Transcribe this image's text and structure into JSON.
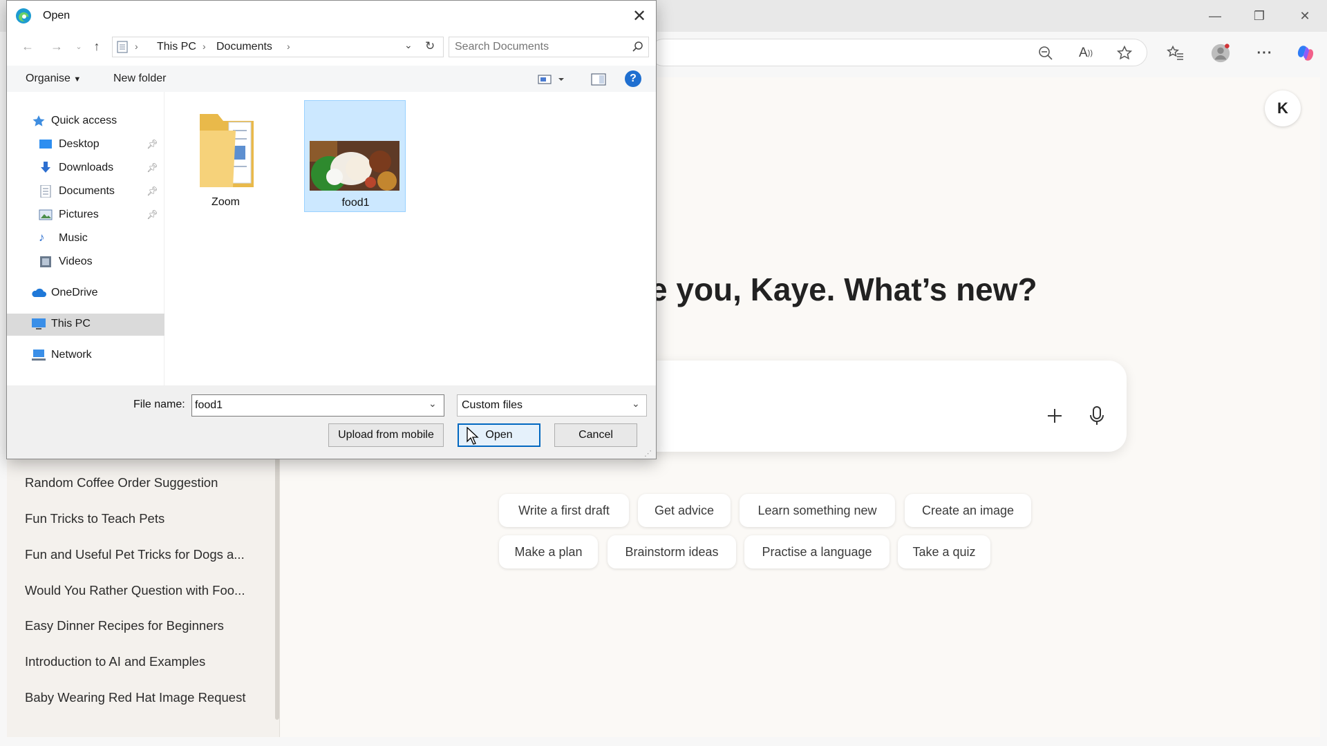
{
  "dialog": {
    "title": "Open",
    "breadcrumb": [
      "This PC",
      "Documents"
    ],
    "search_placeholder": "Search Documents",
    "commands": {
      "organise": "Organise",
      "new_folder": "New folder"
    },
    "nav": {
      "quick_access": "Quick access",
      "desktop": "Desktop",
      "downloads": "Downloads",
      "documents": "Documents",
      "pictures": "Pictures",
      "music": "Music",
      "videos": "Videos",
      "onedrive": "OneDrive",
      "this_pc": "This PC",
      "network": "Network"
    },
    "files": [
      {
        "name": "Zoom",
        "kind": "folder"
      },
      {
        "name": "food1",
        "kind": "image",
        "selected": true
      }
    ],
    "file_name_label": "File name:",
    "file_name_value": "food1",
    "file_type": "Custom files",
    "buttons": {
      "upload": "Upload from mobile",
      "open": "Open",
      "cancel": "Cancel"
    }
  },
  "browser": {
    "avatar_letter": "K",
    "greeting": "e you, Kaye. What’s new?",
    "suggestions": [
      "Write a first draft",
      "Get advice",
      "Learn something new",
      "Create an image",
      "Make a plan",
      "Brainstorm ideas",
      "Practise a language",
      "Take a quiz"
    ],
    "conversations": [
      "Random Coffee Order Suggestion",
      "Fun Tricks to Teach Pets",
      "Fun and Useful Pet Tricks for Dogs a...",
      "Would You Rather Question with Foo...",
      "Easy Dinner Recipes for Beginners",
      "Introduction to AI and Examples",
      "Baby Wearing Red Hat Image Request"
    ]
  },
  "colors": {
    "accent": "#0067c0",
    "selection": "#cce8ff",
    "folder": "#f3c956"
  },
  "icons": {
    "close": "close-icon",
    "search": "search-icon",
    "back": "arrow-left-icon",
    "forward": "arrow-right-icon",
    "up": "arrow-up-icon",
    "refresh": "refresh-icon",
    "help": "help-icon",
    "star": "star-icon",
    "menu": "more-icon",
    "mic": "microphone-icon",
    "plus": "plus-icon"
  }
}
